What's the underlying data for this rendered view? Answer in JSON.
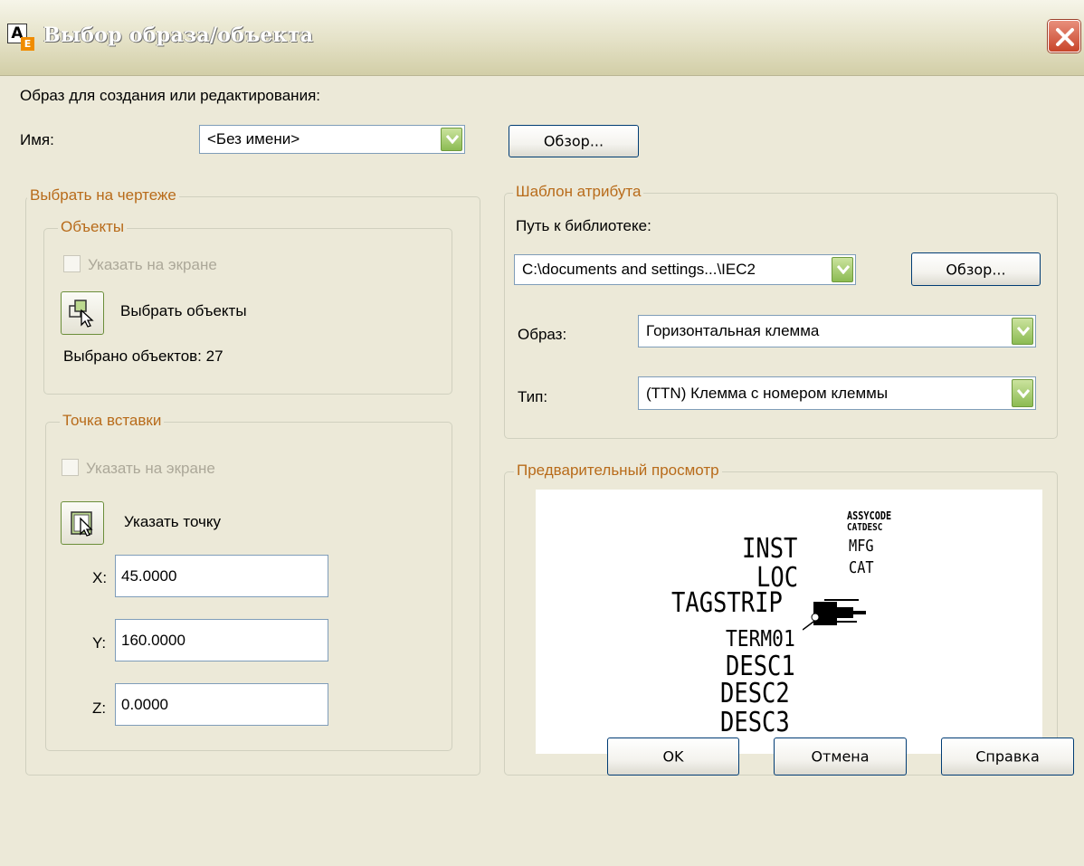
{
  "window": {
    "title": "Выбор образа/объекта"
  },
  "header": {
    "subtitle": "Образ для создания или редактирования:"
  },
  "name_row": {
    "label": "Имя:",
    "value": "<Без имени>",
    "browse_label": "Обзор..."
  },
  "pick_group": {
    "title": "Выбрать на чертеже",
    "objects": {
      "title": "Объекты",
      "specify_on_screen": "Указать на экране",
      "select_label": "Выбрать объекты",
      "count_text": "Выбрано объектов: 27"
    },
    "insertion": {
      "title": "Точка вставки",
      "specify_on_screen": "Указать на экране",
      "pick_point_label": "Указать точку",
      "x_label": "X:",
      "x_value": "45.0000",
      "y_label": "Y:",
      "y_value": "160.0000",
      "z_label": "Z:",
      "z_value": "0.0000"
    }
  },
  "attr_group": {
    "title": "Шаблон атрибута",
    "lib_path_label": "Путь к библиотеке:",
    "lib_path_value": "C:\\documents and settings...\\IEC2",
    "browse_label": "Обзор...",
    "image_label": "Образ:",
    "image_value": "Горизонтальная клемма",
    "type_label": "Тип:",
    "type_value": "(TTN) Клемма с номером клеммы"
  },
  "preview_group": {
    "title": "Предварительный просмотр",
    "texts": {
      "assycode": "ASSYCODE",
      "catdesc": "CATDESC",
      "mfg": "MFG",
      "cat": "CAT",
      "inst": "INST",
      "loc": "LOC",
      "tagstrip": "TAGSTRIP",
      "term": "TERM01",
      "desc1": "DESC1",
      "desc2": "DESC2",
      "desc3": "DESC3"
    }
  },
  "footer": {
    "ok": "OK",
    "cancel": "Отмена",
    "help": "Справка"
  },
  "colors": {
    "group_title": "#b86b1a",
    "dropdown_arrow": "#8cbb53",
    "close": "#c8452a"
  },
  "icons": [
    "autocad-app-icon",
    "close-icon",
    "dropdown-arrow-icon",
    "select-objects-icon",
    "pick-point-icon"
  ]
}
